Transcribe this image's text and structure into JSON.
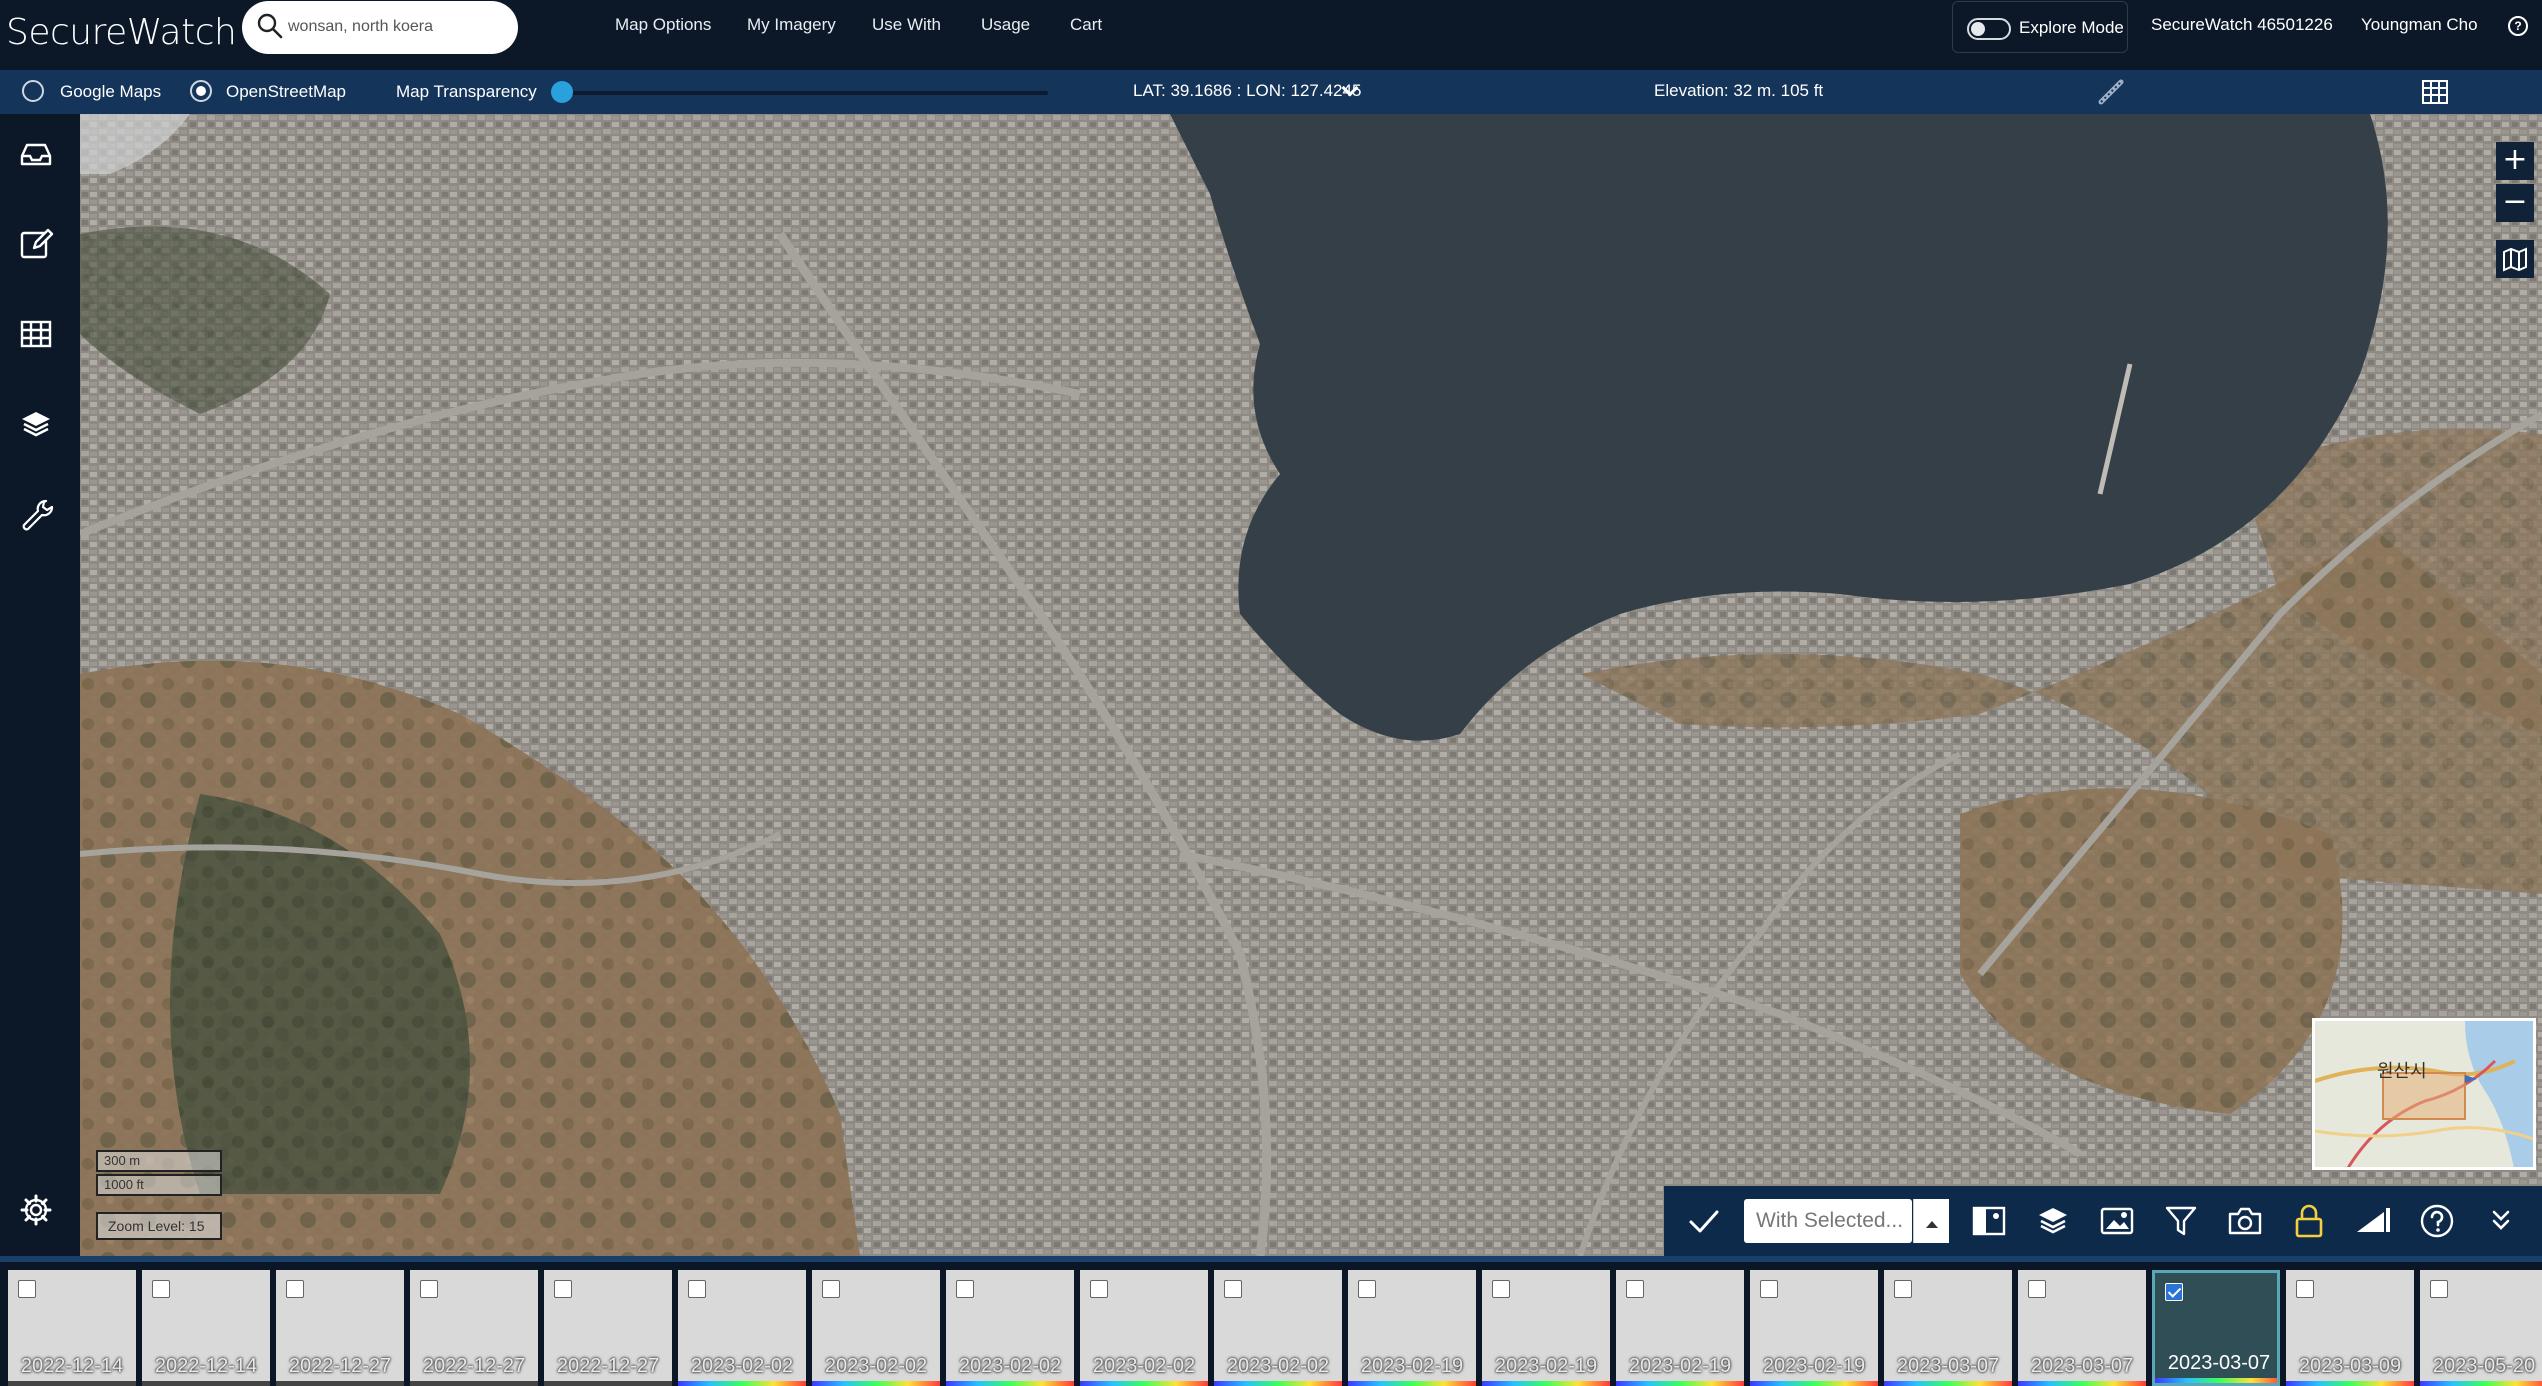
{
  "app": {
    "brand": "SecureWatch"
  },
  "search": {
    "value": "wonsan, north koera"
  },
  "nav": [
    "Map Options",
    "My Imagery",
    "Use With",
    "Usage",
    "Cart"
  ],
  "explore": {
    "label": "Explore Mode"
  },
  "account": {
    "id_label": "SecureWatch 46501226",
    "user": "Youngman Cho",
    "help": "?"
  },
  "subbar": {
    "google": "Google Maps",
    "osm": "OpenStreetMap",
    "transparency": "Map Transparency",
    "transparency_value": 0,
    "latlon": "LAT: 39.1686 : LON: 127.4245",
    "elevation": "Elevation: 32 m. 105 ft"
  },
  "map": {
    "zoom_in": "+",
    "zoom_out": "−",
    "scale_m": "300 m",
    "scale_ft": "1000 ft",
    "zoom_level": "Zoom Level: 15",
    "minimap_label": "원산시"
  },
  "toolbar": {
    "with_selected": "With Selected..."
  },
  "filmstrip": [
    {
      "date": "2022-12-14",
      "checked": false
    },
    {
      "date": "2022-12-14",
      "checked": false
    },
    {
      "date": "2022-12-27",
      "checked": false
    },
    {
      "date": "2022-12-27",
      "checked": false
    },
    {
      "date": "2022-12-27",
      "checked": false
    },
    {
      "date": "2023-02-02",
      "checked": false
    },
    {
      "date": "2023-02-02",
      "checked": false
    },
    {
      "date": "2023-02-02",
      "checked": false
    },
    {
      "date": "2023-02-02",
      "checked": false
    },
    {
      "date": "2023-02-02",
      "checked": false
    },
    {
      "date": "2023-02-19",
      "checked": false
    },
    {
      "date": "2023-02-19",
      "checked": false
    },
    {
      "date": "2023-02-19",
      "checked": false
    },
    {
      "date": "2023-02-19",
      "checked": false
    },
    {
      "date": "2023-03-07",
      "checked": false
    },
    {
      "date": "2023-03-07",
      "checked": false
    },
    {
      "date": "2023-03-07",
      "checked": true
    },
    {
      "date": "2023-03-09",
      "checked": false
    },
    {
      "date": "2023-05-20",
      "checked": false
    }
  ],
  "colors": {
    "topbar": "#0c1828",
    "subbar": "#14345a",
    "accent": "#2aa1dc",
    "selected_thumb": "#2f4e56"
  }
}
